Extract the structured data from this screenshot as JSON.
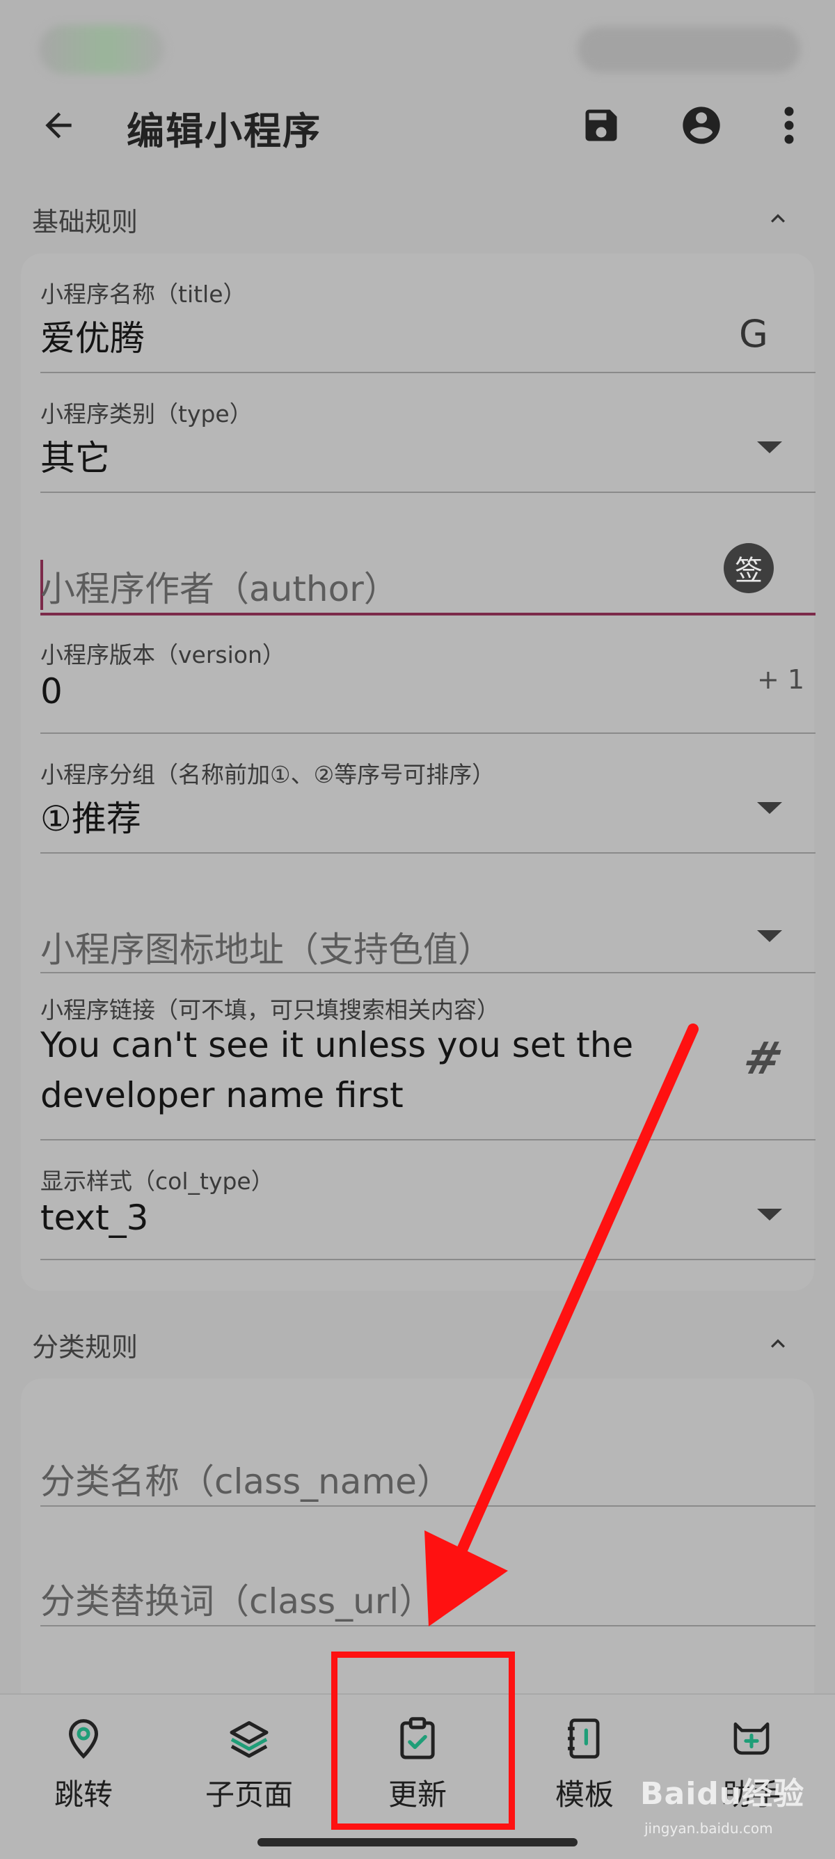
{
  "app_bar": {
    "title": "编辑小程序",
    "back_icon": "arrow-left-icon",
    "save_icon": "save-icon",
    "account_icon": "account-icon",
    "more_icon": "more-vertical-icon"
  },
  "sections": {
    "basic": {
      "title": "基础规则"
    },
    "category": {
      "title": "分类规则"
    }
  },
  "fields": {
    "title": {
      "label": "小程序名称（title）",
      "value": "爱优腾",
      "trailing": "G"
    },
    "type": {
      "label": "小程序类别（type）",
      "value": "其它"
    },
    "author": {
      "placeholder": "小程序作者（author）",
      "trailing": "签"
    },
    "version": {
      "label": "小程序版本（version）",
      "value": "0",
      "trailing": "+ 1"
    },
    "group": {
      "label": "小程序分组（名称前加①、②等序号可排序）",
      "value": "①推荐"
    },
    "icon_url": {
      "placeholder": "小程序图标地址（支持色值）"
    },
    "link": {
      "label": "小程序链接（可不填，可只填搜索相关内容）",
      "value_line1": "You can't see it unless you set the",
      "value_line2": "developer name first",
      "trailing": "#"
    },
    "col_type": {
      "label": "显示样式（col_type）",
      "value": "text_3"
    },
    "class_name": {
      "placeholder": "分类名称（class_name）"
    },
    "class_url": {
      "placeholder": "分类替换词（class_url）"
    }
  },
  "bottom_nav": [
    {
      "label": "跳转",
      "icon": "location-pin-icon"
    },
    {
      "label": "子页面",
      "icon": "layers-icon"
    },
    {
      "label": "更新",
      "icon": "clipboard-check-icon"
    },
    {
      "label": "模板",
      "icon": "notebook-icon"
    },
    {
      "label": "助手",
      "icon": "robot-cat-icon"
    }
  ],
  "watermark": {
    "main": "Baidu经验",
    "sub": "jingyan.baidu.com"
  },
  "colors": {
    "focus_accent": "#7c2a4a",
    "annotation_red": "#ff1111",
    "nav_accent": "#1f9e78"
  }
}
